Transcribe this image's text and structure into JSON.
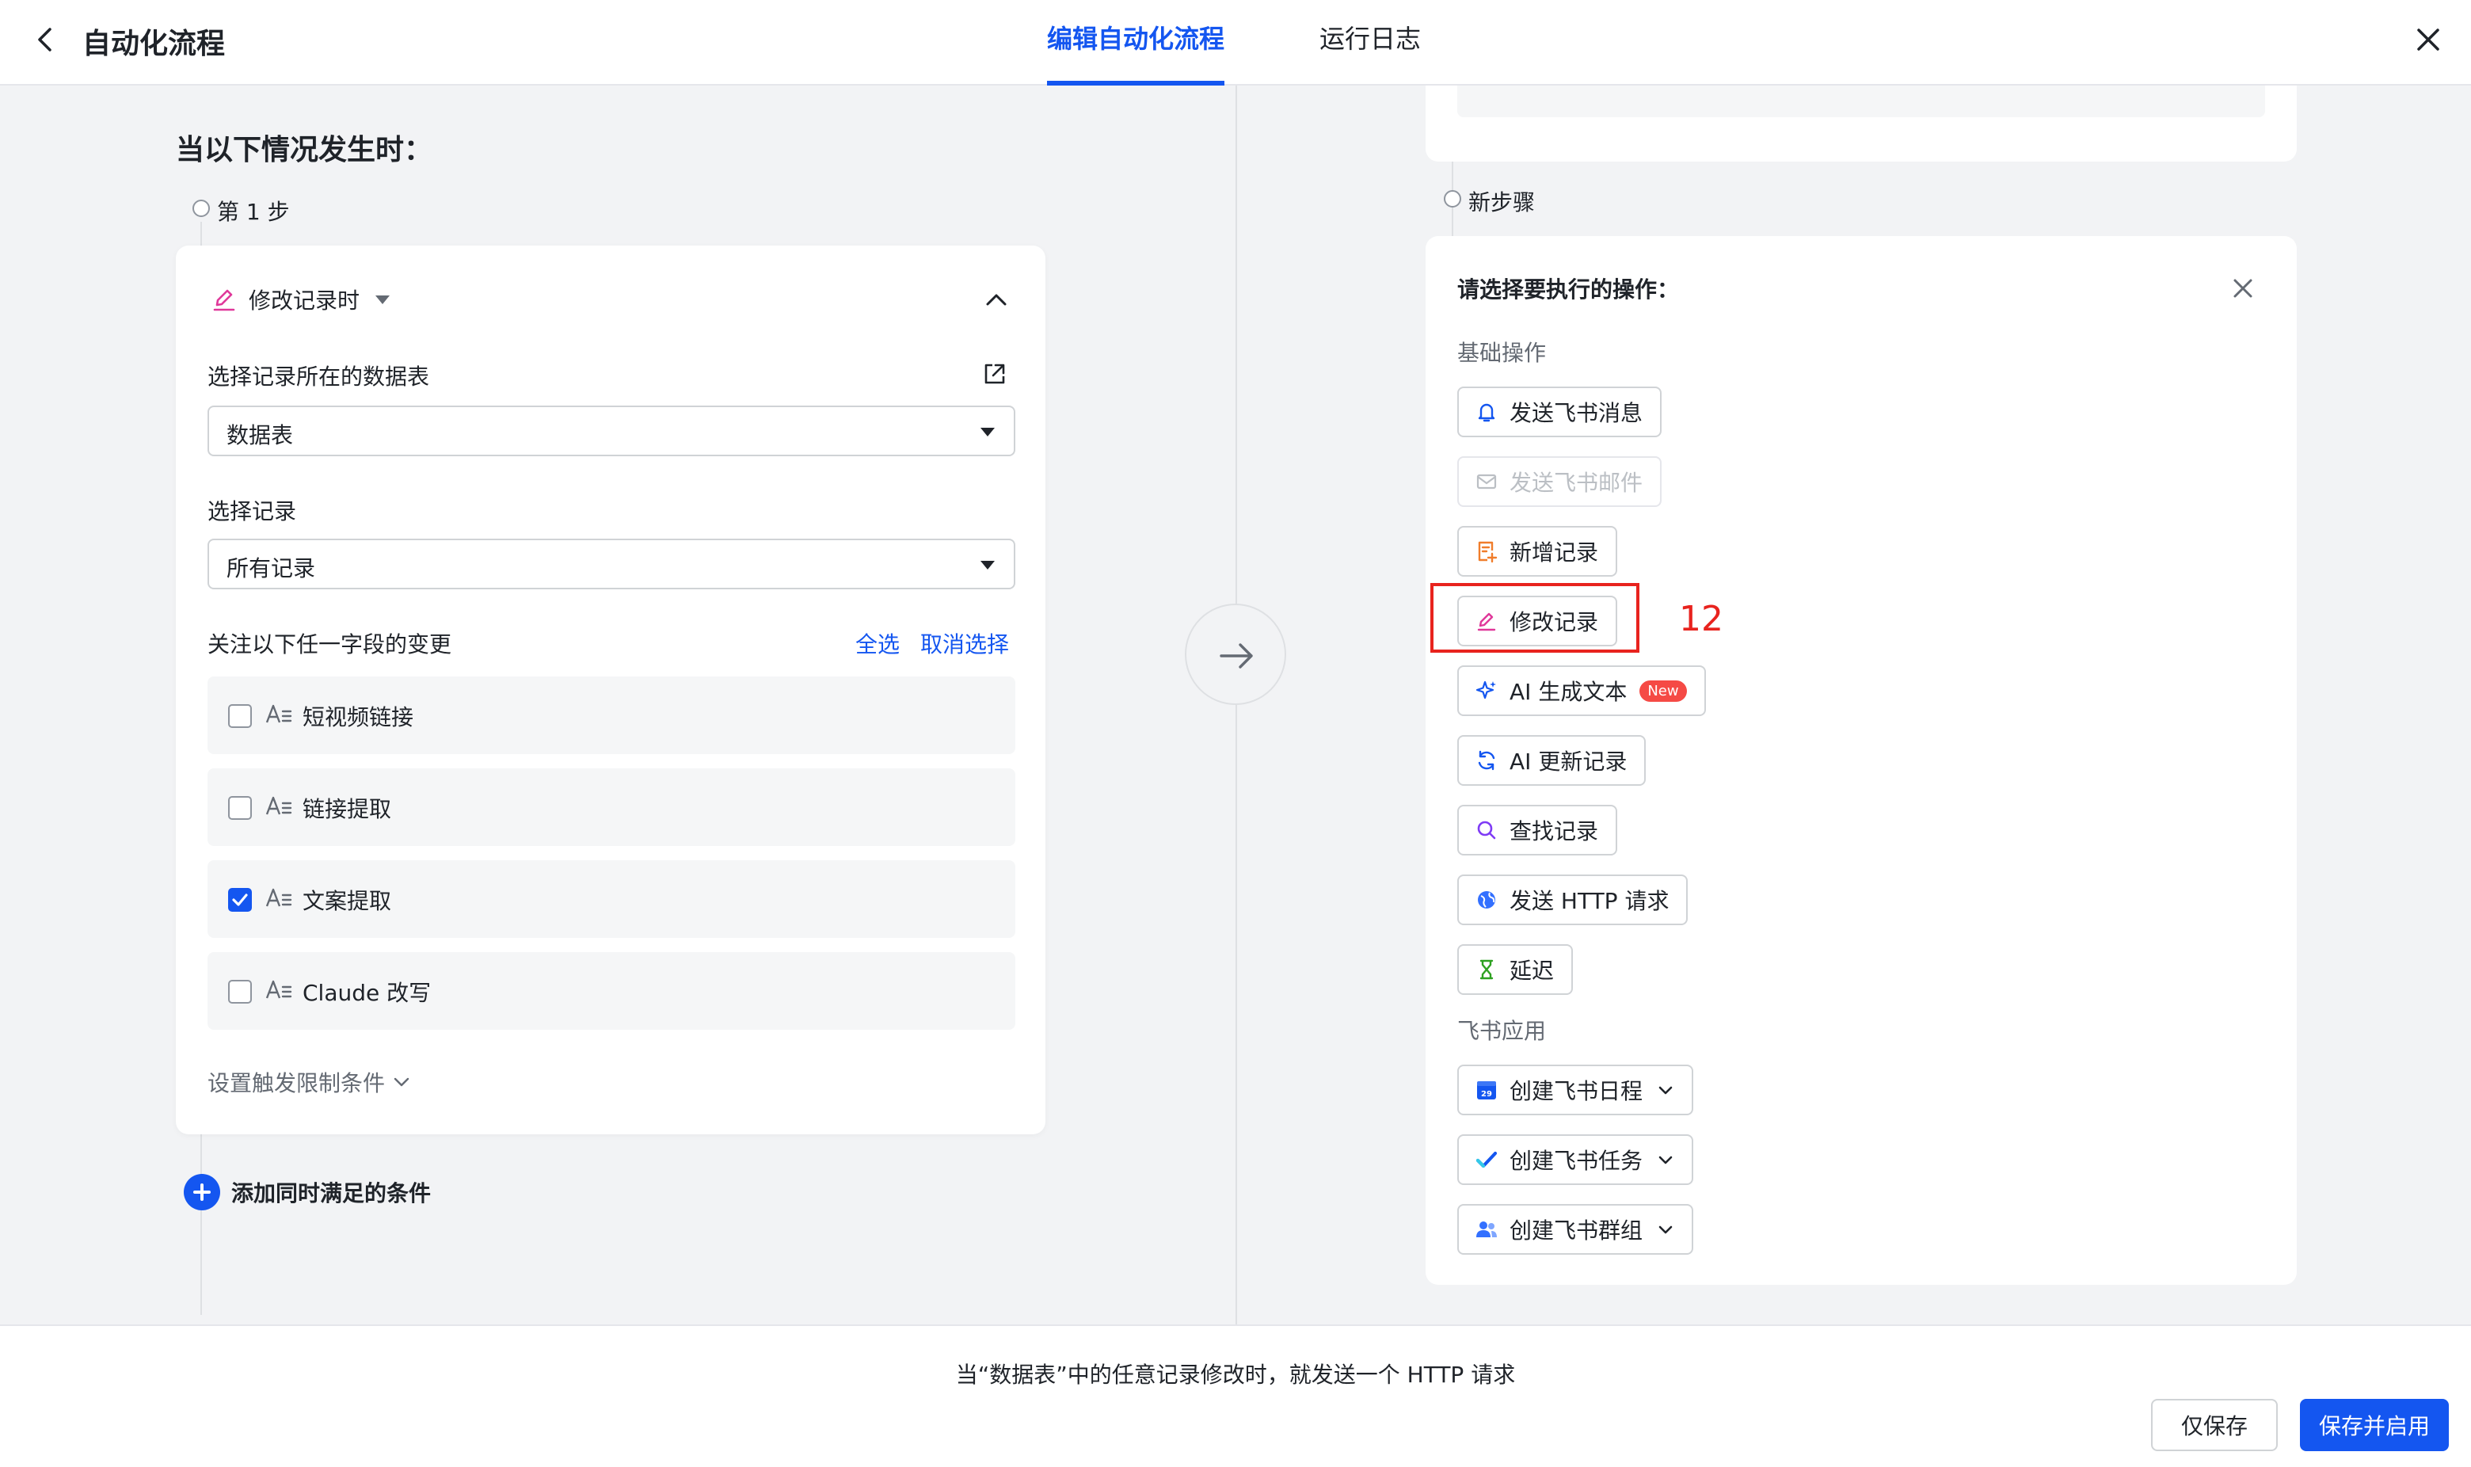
{
  "header": {
    "title": "自动化流程",
    "tabs": [
      {
        "label": "编辑自动化流程",
        "active": true
      },
      {
        "label": "运行日志",
        "active": false
      }
    ]
  },
  "trigger": {
    "heading": "当以下情况发生时：",
    "step_label": "第 1 步",
    "type_label": "修改记录时",
    "table_label": "选择记录所在的数据表",
    "table_value": "数据表",
    "record_label": "选择记录",
    "record_value": "所有记录",
    "watch_label": "关注以下任一字段的变更",
    "select_all": "全选",
    "deselect": "取消选择",
    "fields": [
      {
        "name": "短视频链接",
        "checked": false
      },
      {
        "name": "链接提取",
        "checked": false
      },
      {
        "name": "文案提取",
        "checked": true
      },
      {
        "name": "Claude 改写",
        "checked": false
      }
    ],
    "limit_label": "设置触发限制条件",
    "add_condition": "添加同时满足的条件"
  },
  "action": {
    "step_label": "新步骤",
    "title": "请选择要执行的操作：",
    "basic_section": "基础操作",
    "basic_ops": [
      {
        "label": "发送飞书消息",
        "icon": "bell-icon",
        "disabled": false
      },
      {
        "label": "发送飞书邮件",
        "icon": "mail-icon",
        "disabled": true
      },
      {
        "label": "新增记录",
        "icon": "add-record-icon",
        "disabled": false
      },
      {
        "label": "修改记录",
        "icon": "pencil-icon",
        "disabled": false
      },
      {
        "label": "AI 生成文本",
        "icon": "sparkle-icon",
        "disabled": false,
        "badge": "New"
      },
      {
        "label": "AI 更新记录",
        "icon": "refresh-icon",
        "disabled": false
      },
      {
        "label": "查找记录",
        "icon": "search-icon",
        "disabled": false
      },
      {
        "label": "发送 HTTP 请求",
        "icon": "globe-icon",
        "disabled": false
      },
      {
        "label": "延迟",
        "icon": "hourglass-icon",
        "disabled": false
      }
    ],
    "app_section": "飞书应用",
    "app_ops": [
      {
        "label": "创建飞书日程",
        "icon": "calendar-icon",
        "calendar_day": "29"
      },
      {
        "label": "创建飞书任务",
        "icon": "task-check-icon"
      },
      {
        "label": "创建飞书群组",
        "icon": "group-icon"
      }
    ]
  },
  "annotation": {
    "number": "12",
    "color": "#e8231e"
  },
  "footer": {
    "summary": "当“数据表”中的任意记录修改时，就发送一个 HTTP 请求",
    "save_label": "仅保存",
    "save_enable_label": "保存并启用"
  },
  "colors": {
    "accent": "#1456f0",
    "pink": "#e0389a",
    "orange": "#f07d2b",
    "green": "#2ea121",
    "purple": "#7f3bf5"
  }
}
